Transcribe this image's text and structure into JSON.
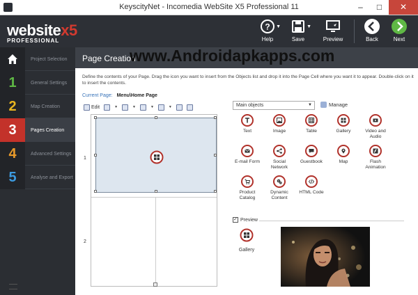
{
  "window": {
    "title": "KeyscityNet - Incomedia WebSite X5 Professional 11",
    "min": "–",
    "max": "□",
    "close": "✕"
  },
  "logo": {
    "main": "website",
    "accent": "x5",
    "sub": "PROFESSIONAL"
  },
  "toolbar": {
    "help": "Help",
    "save": "Save",
    "preview": "Preview",
    "back": "Back",
    "next": "Next"
  },
  "sidebar": {
    "items": [
      {
        "num": "",
        "label": "Project Selection"
      },
      {
        "num": "1",
        "label": "General Settings"
      },
      {
        "num": "2",
        "label": "Map Creation"
      },
      {
        "num": "3",
        "label": "Pages Creation"
      },
      {
        "num": "4",
        "label": "Advanced Settings"
      },
      {
        "num": "5",
        "label": "Analyse and Export"
      }
    ]
  },
  "page": {
    "title": "Page Creation",
    "watermark": "www.Androidapkapps.com",
    "description": "Define the contents of your Page. Drag the icon you want to insert from the Objects list and drop it into the Page Cell where you want it to appear. Double-click on it to insert the contents.",
    "current_page_label": "Current Page:",
    "current_page_value": "Menu\\Home Page",
    "edit_label": "Edit",
    "row1": "1",
    "row2": "2"
  },
  "objects": {
    "selected": "Main objects",
    "manage": "Manage",
    "items": [
      {
        "label": "Text",
        "glyph": "T"
      },
      {
        "label": "Image",
        "glyph": "▣"
      },
      {
        "label": "Table",
        "glyph": "▦"
      },
      {
        "label": "Gallery",
        "glyph": "⊞"
      },
      {
        "label": "Video and Audio",
        "glyph": "▶"
      },
      {
        "label": "E-mail Form",
        "glyph": "✉"
      },
      {
        "label": "Social Network",
        "glyph": "⋖"
      },
      {
        "label": "Guestbook",
        "glyph": "✎"
      },
      {
        "label": "Map",
        "glyph": "●"
      },
      {
        "label": "Flash Animation",
        "glyph": "ϟ"
      },
      {
        "label": "Product Catalog",
        "glyph": "⊡"
      },
      {
        "label": "Dynamic Content",
        "glyph": "✿"
      },
      {
        "label": "HTML Code",
        "glyph": "</>"
      }
    ]
  },
  "preview": {
    "label": "Preview",
    "checked": "✓",
    "object_label": "Gallery"
  },
  "colors": {
    "accent_red": "#c3322a",
    "dark_bg": "#2b2e33",
    "cell_bg": "#dde6ef",
    "link_blue": "#3672b8",
    "next_green": "#5fb845"
  }
}
